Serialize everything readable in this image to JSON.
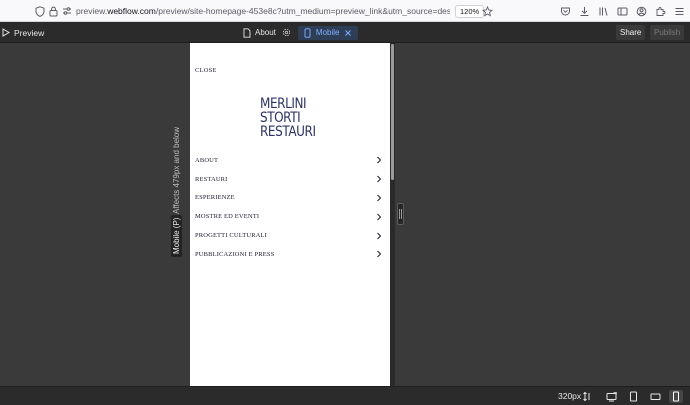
{
  "browser": {
    "url_prefix": "preview.",
    "url_domain": "webflow.com",
    "url_rest": "/preview/site-homepage-453e8c?utm_medium=preview_link&utm_source=designer&utm_conte",
    "zoom": "120%"
  },
  "toolbar": {
    "preview_label": "Preview",
    "page_label": "About",
    "breakpoint_label": "Mobile",
    "share_label": "Share",
    "publish_label": "Publish"
  },
  "canvas": {
    "affects_label": "Affects 479px and below",
    "breakpoint_tag": "Mobile (P)"
  },
  "site": {
    "close_label": "CLOSE",
    "logo_lines": [
      "MERLINI",
      "STORTI",
      "RESTAURI"
    ],
    "menu": [
      {
        "label": "ABOUT"
      },
      {
        "label": "RESTAURI"
      },
      {
        "label": "ESPERIENZE"
      },
      {
        "label": "MOSTRE ED EVENTI"
      },
      {
        "label": "PROGETTI CULTURALI"
      },
      {
        "label": "PUBBLICAZIONI E PRESS"
      }
    ]
  },
  "bottom_bar": {
    "width_label": "320px"
  },
  "colors": {
    "logo": "#2d3464",
    "menu_text": "#1d1d2e",
    "accent": "#7fb2ff",
    "canvas_bg": "#3a3a3a"
  }
}
